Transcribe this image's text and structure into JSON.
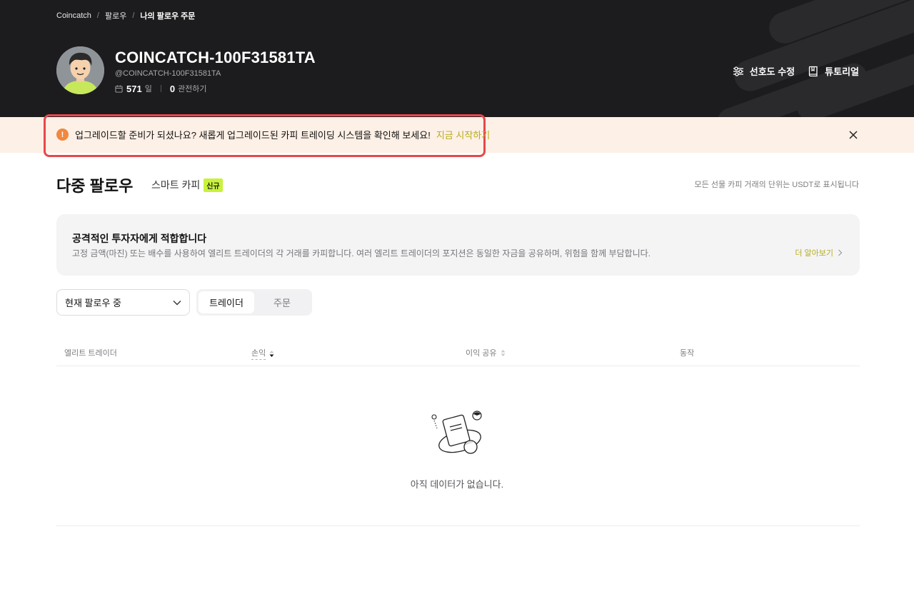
{
  "breadcrumb": [
    "Coincatch",
    "팔로우",
    "나의 팔로우 주문"
  ],
  "breadcrumb_separator": "/",
  "profile": {
    "name": "COINCATCH-100F31581TA",
    "handle": "@COINCATCH-100F31581TA",
    "days_value": "571",
    "days_unit": "일",
    "watch_value": "0",
    "watch_label": "관전하기"
  },
  "header_actions": {
    "preferences": "선호도 수정",
    "tutorial": "튜토리얼"
  },
  "banner": {
    "message": "업그레이드할 준비가 되셨나요? 새롭게 업그레이드된 카피 트레이딩 시스템을 확인해 보세요!",
    "link": "지금 시작하기",
    "icon": "!"
  },
  "main": {
    "title": "다중 팔로우",
    "smart_copy_tab": "스마트 카피",
    "new_badge": "신규",
    "unit_note": "모든 선물 카피 거래의 단위는 USDT로 표시됩니다"
  },
  "info_card": {
    "title": "공격적인 투자자에게 적합합니다",
    "description": "고정 금액(마진) 또는 배수를 사용하여 엘리트 트레이더의 각 거래를 카피합니다. 여러 엘리트 트레이더의 포지션은 동일한 자금을 공유하며, 위험을 함께 부담합니다.",
    "more": "더 알아보기"
  },
  "filters": {
    "select_value": "현재 팔로우 중",
    "segments": [
      "트레이더",
      "주문"
    ],
    "active_segment": "트레이더"
  },
  "table": {
    "columns": [
      "엘리트 트레이더",
      "손익",
      "이익 공유",
      "동작"
    ]
  },
  "empty_state": {
    "text": "아직 데이터가 없습니다."
  },
  "colors": {
    "header_bg": "#1c1c1e",
    "banner_bg": "#fdf0e6",
    "accent_link": "#b5ad1e",
    "badge": "#c9f23a",
    "warning": "#f0883e",
    "highlight_border": "#e5484d"
  }
}
